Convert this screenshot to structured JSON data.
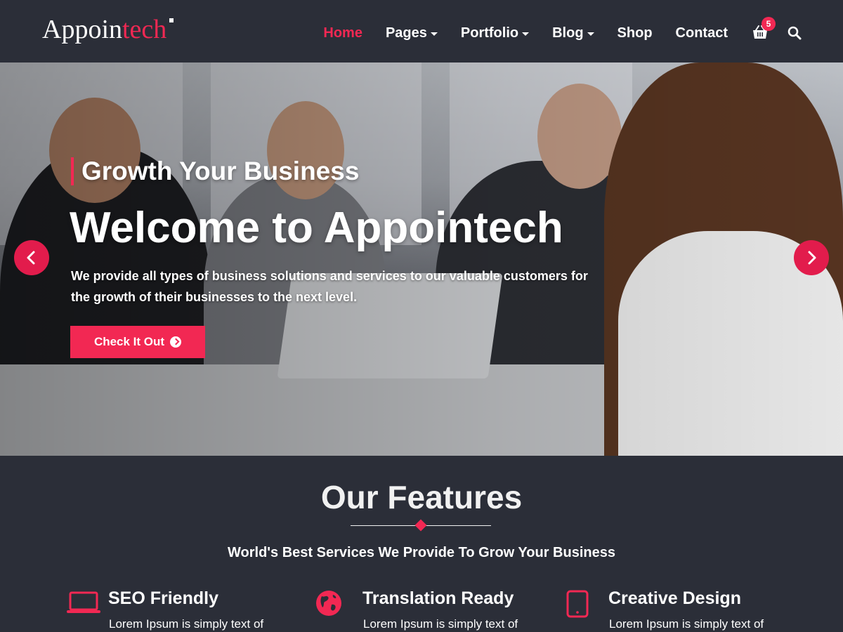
{
  "brand": {
    "name_prefix": "Appoin",
    "name_suffix": "tech"
  },
  "nav": {
    "items": [
      {
        "label": "Home",
        "active": true,
        "has_dropdown": false
      },
      {
        "label": "Pages",
        "active": false,
        "has_dropdown": true
      },
      {
        "label": "Portfolio",
        "active": false,
        "has_dropdown": true
      },
      {
        "label": "Blog",
        "active": false,
        "has_dropdown": true
      },
      {
        "label": "Shop",
        "active": false,
        "has_dropdown": false
      },
      {
        "label": "Contact",
        "active": false,
        "has_dropdown": false
      }
    ],
    "cart_count": "5",
    "cart_icon": "shopping-basket-icon",
    "search_icon": "search-icon"
  },
  "hero": {
    "subtitle": "Growth Your Business",
    "title": "Welcome to Appointech",
    "description": "We provide all types of business solutions and services to our valuable customers for the growth of their businesses to the next level.",
    "button_label": "Check It Out",
    "prev_icon": "chevron-left-icon",
    "next_icon": "chevron-right-icon"
  },
  "features": {
    "title": "Our Features",
    "subtitle": "World's Best Services We Provide To Grow Your Business",
    "items": [
      {
        "title": "SEO Friendly",
        "text": "Lorem Ipsum is simply text of",
        "icon": "laptop-icon"
      },
      {
        "title": "Translation Ready",
        "text": "Lorem Ipsum is simply text of",
        "icon": "globe-icon"
      },
      {
        "title": "Creative Design",
        "text": "Lorem Ipsum is simply text of",
        "icon": "tablet-icon"
      }
    ]
  },
  "colors": {
    "accent": "#f22853",
    "background": "#2b2e38",
    "text": "#ffffff"
  }
}
